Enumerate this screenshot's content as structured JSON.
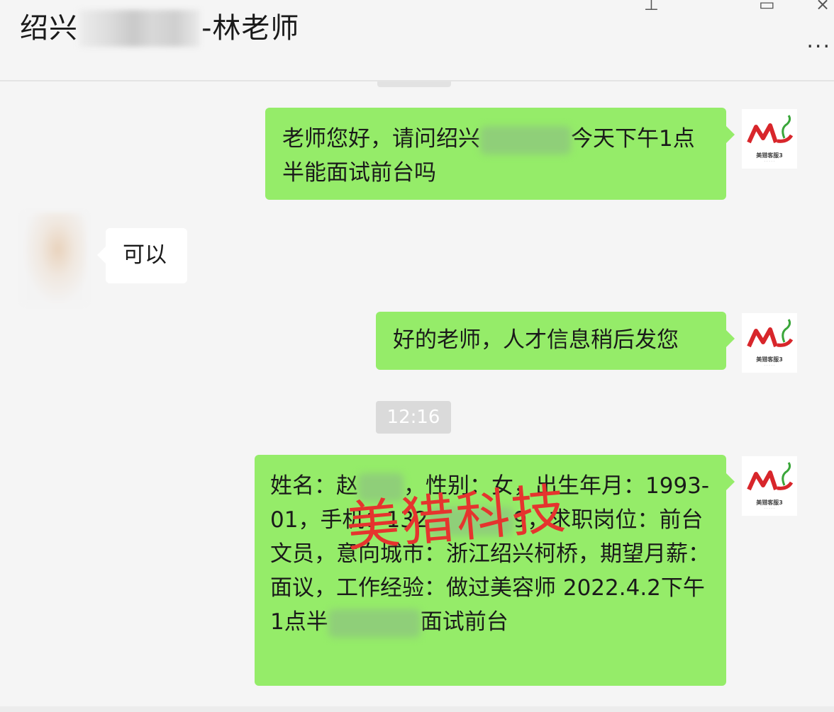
{
  "header": {
    "title_prefix": "绍兴",
    "title_suffix": "-林老师",
    "more_label": "..."
  },
  "messages": [
    {
      "side": "me",
      "text_before": "老师您好，请问绍兴",
      "text_after": "今天下午1点半能面试前台吗"
    },
    {
      "side": "other",
      "text": "可以"
    },
    {
      "side": "me",
      "text": "好的老师，人才信息稍后发您"
    },
    {
      "side": "me",
      "text_before": "姓名：赵",
      "text_after": "，性别：女，出生年月：1993-01，手机：132",
      "text_after2": "9，求职岗位：前台文员，意向城市：浙江绍兴柯桥，期望月薪：面议，工作经验：做过美容师 2022.4.2下午1点半",
      "text_after3": "面试前台"
    }
  ],
  "timestamp": "12:16",
  "watermark": "美猎科技",
  "avatar_me": {
    "logo_text": "美猎客服3",
    "icon": "meilie-logo-icon",
    "brand_red": "#d8262b",
    "brand_green": "#3aa63a"
  },
  "colors": {
    "bubble_out": "#95ec69",
    "bubble_in": "#ffffff",
    "background": "#f5f5f5",
    "watermark": "#e5342e"
  }
}
